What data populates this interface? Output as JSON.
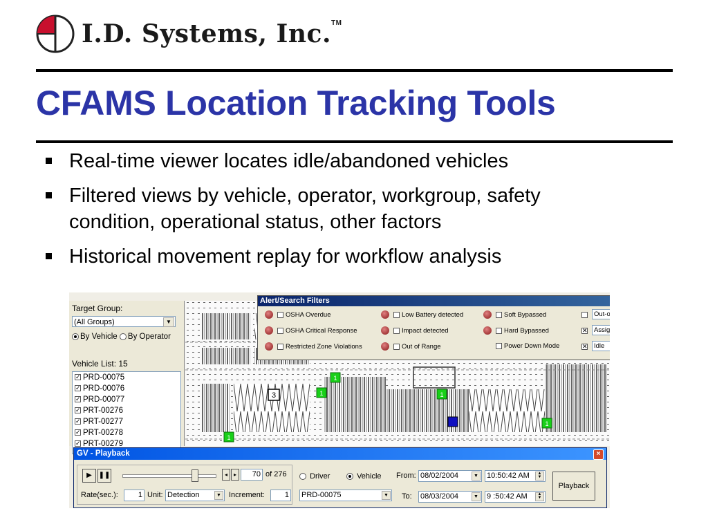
{
  "logo": {
    "name": "I.D. Systems, Inc.",
    "tm": "TM"
  },
  "slide": {
    "title": "CFAMS Location Tracking Tools",
    "bullets": [
      {
        "line1": "Real-time viewer locates idle/abandoned vehicles",
        "line2": ""
      },
      {
        "line1": "Filtered views by vehicle, operator, workgroup, safety",
        "line2": "condition, operational status, other factors"
      },
      {
        "line1": "Historical movement replay for workflow analysis",
        "line2": ""
      }
    ]
  },
  "left_panel": {
    "target_group_label": "Target Group:",
    "target_group_value": "(All Groups)",
    "by_vehicle": "By Vehicle",
    "by_operator": "By Operator",
    "vehicle_list_label": "Vehicle List:  15",
    "vehicles": [
      "PRD-00075",
      "PRD-00076",
      "PRD-00077",
      "PRT-00276",
      "PRT-00277",
      "PRT-00278",
      "PRT-00279"
    ]
  },
  "map": {
    "markers": [
      "1",
      "1",
      "1",
      "1",
      "1",
      "1",
      "3"
    ]
  },
  "alert_filters": {
    "title": "Alert/Search Filters",
    "close": "×",
    "rows": [
      {
        "a": "OSHA Overdue",
        "b": "Low Battery detected",
        "c": "Soft Bypassed",
        "sel": "Out-of-Service",
        "sel_checked": ""
      },
      {
        "a": "OSHA Critical Response",
        "b": "Impact detected",
        "c": "Hard Bypassed",
        "sel": "Assigned",
        "sel_checked": "✕"
      },
      {
        "a": "Restricted Zone Violations",
        "b": "Out of Range",
        "c": "Power Down Mode",
        "sel": "Idle",
        "sel_checked": "✕"
      }
    ]
  },
  "playback": {
    "title": "GV - Playback",
    "close": "×",
    "position": "70",
    "of_total": "of 276",
    "rate_label": "Rate(sec.):",
    "rate_value": "1",
    "unit_label": "Unit:",
    "unit_value": "Detection",
    "increment_label": "Increment:",
    "increment_value": "1",
    "driver_label": "Driver",
    "vehicle_label": "Vehicle",
    "vehicle_value": "PRD-00075",
    "from_label": "From:",
    "from_date": "08/02/2004",
    "from_time": "10:50:42 AM",
    "to_label": "To:",
    "to_date": "08/03/2004",
    "to_time": "9 :50:42 AM",
    "playback_button": "Playback"
  },
  "colors": {
    "title": "#2b34a7",
    "marker_green": "#18d018",
    "marker_blue": "#1010c0",
    "titlebar_blue": "#0054e3"
  }
}
